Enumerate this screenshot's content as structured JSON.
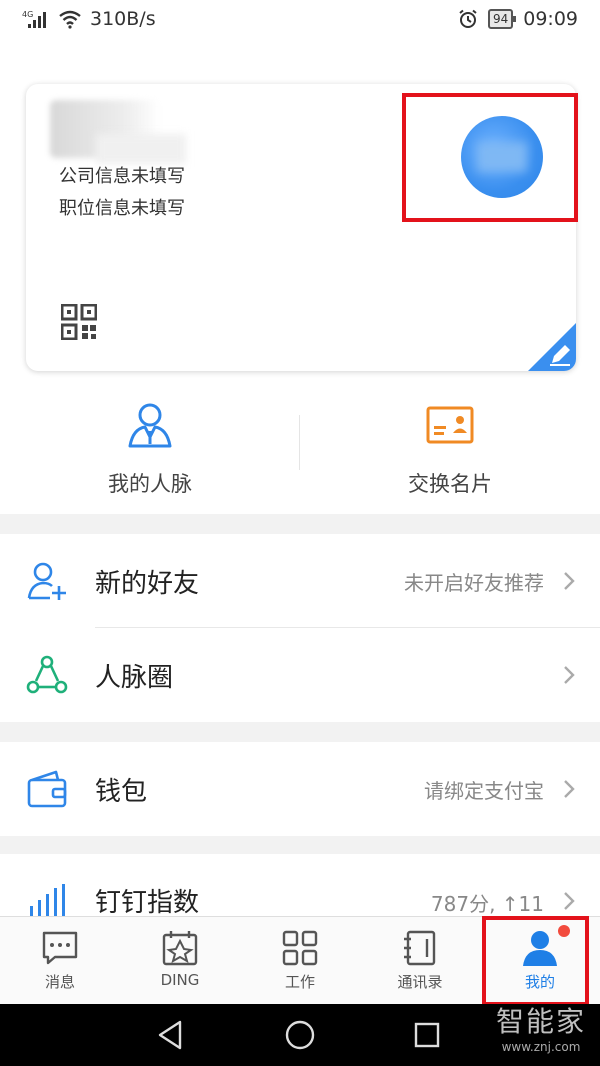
{
  "status_bar": {
    "network": "4G",
    "speed": "310B/s",
    "battery": "94",
    "time": "09:09"
  },
  "profile": {
    "company": "公司信息未填写",
    "position": "职位信息未填写"
  },
  "quick_actions": [
    {
      "label": "我的人脉",
      "icon": "contacts-person-icon"
    },
    {
      "label": "交换名片",
      "icon": "business-card-icon"
    }
  ],
  "list": {
    "new_friends": {
      "label": "新的好友",
      "value": "未开启好友推荐"
    },
    "network_circle": {
      "label": "人脉圈"
    },
    "wallet": {
      "label": "钱包",
      "value": "请绑定支付宝"
    },
    "dingding_index": {
      "label": "钉钉指数",
      "value": "787分, ↑11"
    }
  },
  "tabs": [
    {
      "label": "消息",
      "icon": "message-icon"
    },
    {
      "label": "DING",
      "icon": "ding-icon"
    },
    {
      "label": "工作",
      "icon": "work-grid-icon"
    },
    {
      "label": "通讯录",
      "icon": "contacts-book-icon"
    },
    {
      "label": "我的",
      "icon": "profile-icon",
      "active": true
    }
  ],
  "watermark": {
    "title": "智能家",
    "url": "www.znj.com"
  },
  "colors": {
    "accent_blue": "#1f7fe6",
    "highlight_red": "#e3121b",
    "card_orange": "#f08a24",
    "circle_green": "#1fb07a"
  }
}
